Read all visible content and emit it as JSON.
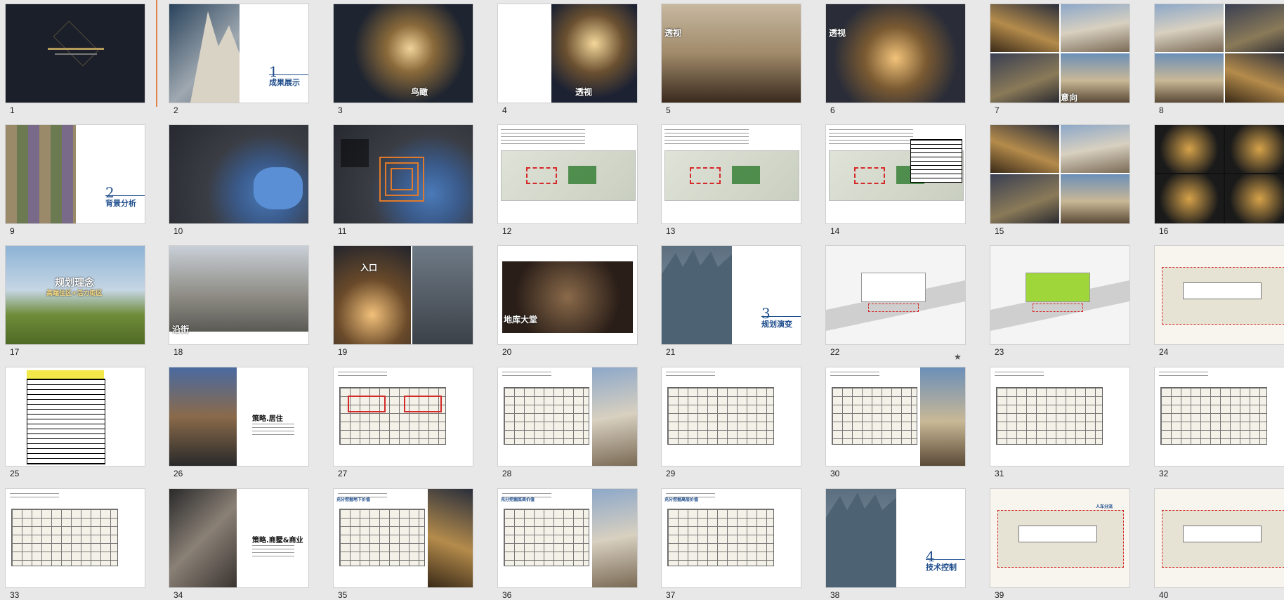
{
  "slides": [
    {
      "number": "1",
      "title": "",
      "style": "cover"
    },
    {
      "number": "2",
      "title": "成果展示",
      "section": "1",
      "style": "section"
    },
    {
      "number": "3",
      "title": "鸟瞰",
      "style": "aerial"
    },
    {
      "number": "4",
      "title": "透视",
      "style": "perspective"
    },
    {
      "number": "5",
      "title": "透视",
      "style": "facade"
    },
    {
      "number": "6",
      "title": "透视",
      "style": "courtyard"
    },
    {
      "number": "7",
      "title": "意向",
      "style": "collage"
    },
    {
      "number": "8",
      "title": "",
      "style": "collage2"
    },
    {
      "number": "9",
      "title": "背景分析",
      "section": "2",
      "style": "section-mosaic"
    },
    {
      "number": "10",
      "title": "",
      "style": "map"
    },
    {
      "number": "11",
      "title": "",
      "style": "map-rings"
    },
    {
      "number": "12",
      "title": "",
      "style": "map-text"
    },
    {
      "number": "13",
      "title": "",
      "style": "map-photos"
    },
    {
      "number": "14",
      "title": "",
      "style": "site-table"
    },
    {
      "number": "15",
      "title": "",
      "style": "photo-grid"
    },
    {
      "number": "16",
      "title": "",
      "style": "night-grid"
    },
    {
      "number": "17",
      "title": "规划理念",
      "subtitle": "高端住区+活力街区",
      "style": "park"
    },
    {
      "number": "18",
      "title": "沿街",
      "style": "street"
    },
    {
      "number": "19",
      "title": "入口",
      "style": "entrance"
    },
    {
      "number": "20",
      "title": "地库大堂",
      "style": "lobby"
    },
    {
      "number": "21",
      "title": "规划演变",
      "section": "3",
      "style": "section-blue"
    },
    {
      "number": "22",
      "title": "",
      "style": "model-white"
    },
    {
      "number": "23",
      "title": "",
      "style": "model-green"
    },
    {
      "number": "24",
      "title": "",
      "style": "site-plan"
    },
    {
      "number": "25",
      "title": "",
      "style": "table"
    },
    {
      "number": "26",
      "title": "策略.居住",
      "style": "pool"
    },
    {
      "number": "27",
      "title": "",
      "style": "plans-red"
    },
    {
      "number": "28",
      "title": "",
      "style": "floor-photo"
    },
    {
      "number": "29",
      "title": "",
      "style": "floor"
    },
    {
      "number": "30",
      "title": "",
      "style": "floor-photo2"
    },
    {
      "number": "31",
      "title": "",
      "style": "floor2"
    },
    {
      "number": "32",
      "title": "",
      "style": "floor3"
    },
    {
      "number": "33",
      "title": "",
      "style": "floor4"
    },
    {
      "number": "34",
      "title": "策略.商墅&商业",
      "style": "corridor"
    },
    {
      "number": "35",
      "title": "充分挖掘地下价值",
      "style": "section-curve"
    },
    {
      "number": "36",
      "title": "充分挖掘底商价值",
      "style": "shops"
    },
    {
      "number": "37",
      "title": "充分挖掘高层价值",
      "style": "shops2"
    },
    {
      "number": "38",
      "title": "技术控制",
      "section": "4",
      "style": "section-blue2"
    },
    {
      "number": "39",
      "title": "人车分流",
      "style": "traffic"
    },
    {
      "number": "40",
      "title": "",
      "style": "traffic2"
    }
  ],
  "colors": {
    "accent": "#1e4d8c",
    "insert": "#e0824a"
  }
}
